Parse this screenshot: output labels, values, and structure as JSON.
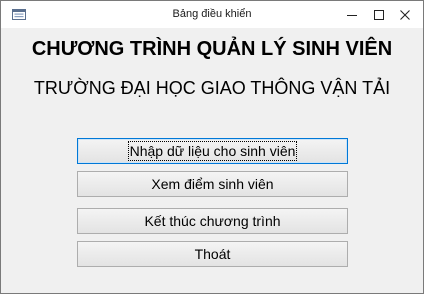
{
  "window": {
    "title": "Bảng điều khiển",
    "controls": {
      "minimize": "minimize-icon",
      "maximize": "maximize-icon",
      "close": "close-icon"
    }
  },
  "form": {
    "title": "CHƯƠNG TRÌNH QUẢN LÝ SINH VIÊN",
    "subtitle": "TRƯỜNG ĐẠI HỌC GIAO THÔNG VẬN TẢI"
  },
  "buttons": [
    {
      "label": "Nhập dữ liệu cho sinh viên",
      "focused": true
    },
    {
      "label": "Xem điểm sinh viên",
      "focused": false
    },
    {
      "label": "Kết thúc chương trình",
      "focused": false
    },
    {
      "label": "Thoát",
      "focused": false
    }
  ],
  "colors": {
    "focus_border": "#0078d7",
    "window_bg": "#f0f0f0"
  }
}
